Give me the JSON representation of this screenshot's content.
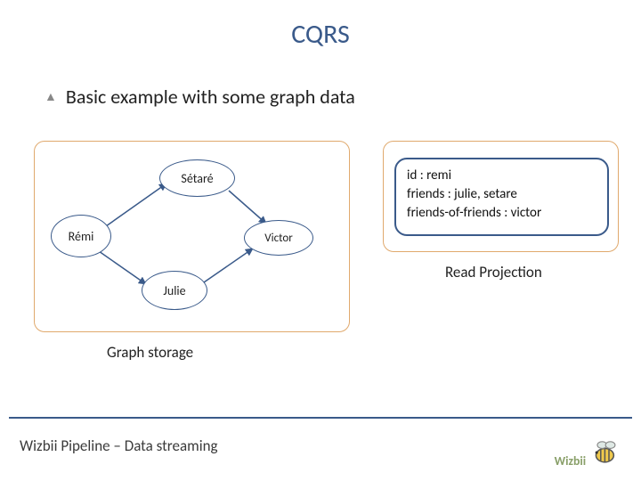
{
  "title": "CQRS",
  "bullet": "Basic example with some graph data",
  "graph": {
    "nodes": {
      "remi": "Rémi",
      "setare": "Sétaré",
      "julie": "Julie",
      "victor": "Victor"
    },
    "caption": "Graph storage"
  },
  "projection": {
    "lines": {
      "l1": "id : remi",
      "l2": "friends : julie, setare",
      "l3": "friends-of-friends : victor"
    },
    "caption": "Read Projection"
  },
  "footer": "Wizbii Pipeline – Data streaming",
  "logo_text": "Wizbii"
}
